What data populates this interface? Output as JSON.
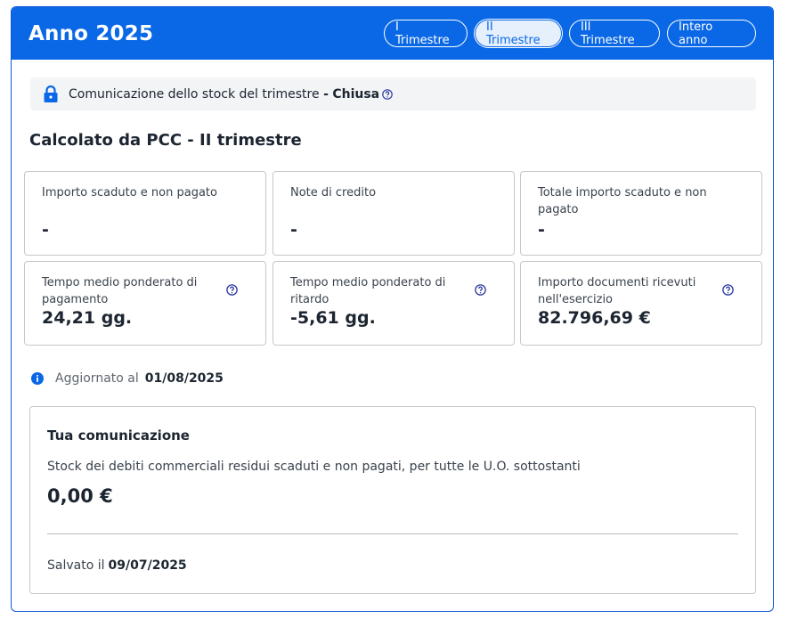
{
  "header": {
    "title": "Anno 2025",
    "tabs": [
      {
        "label": "I Trimestre",
        "active": false
      },
      {
        "label": "II Trimestre",
        "active": true
      },
      {
        "label": "III Trimestre",
        "active": false
      },
      {
        "label": "Intero anno",
        "active": false
      }
    ]
  },
  "status": {
    "text": "Comunicazione dello stock del trimestre",
    "separator": "-",
    "state": "Chiusa",
    "icon": "lock-icon"
  },
  "section": {
    "title": "Calcolato da PCC - II trimestre"
  },
  "cards": [
    {
      "label": "Importo scaduto e non pagato",
      "value": "-"
    },
    {
      "label": "Note di credito",
      "value": "-"
    },
    {
      "label": "Totale importo scaduto e non pagato",
      "value": "-"
    },
    {
      "label": "Tempo medio ponderato di pagamento",
      "value": "24,21 gg."
    },
    {
      "label": "Tempo medio ponderato di ritardo",
      "value": "-5,61 gg."
    },
    {
      "label": "Importo documenti ricevuti nell'esercizio",
      "value": "82.796,69 €"
    }
  ],
  "updated": {
    "label": "Aggiornato al",
    "date": "01/08/2025"
  },
  "communication": {
    "title": "Tua comunicazione",
    "description": "Stock dei debiti commerciali residui scaduti e non pagati, per tutte le U.O. sottostanti",
    "amount": "0,00 €",
    "saved_label": "Salvato il",
    "saved_date": "09/07/2025"
  },
  "colors": {
    "primary": "#0a68e6",
    "help": "#2d3a9e",
    "border": "#c5c7cb"
  }
}
